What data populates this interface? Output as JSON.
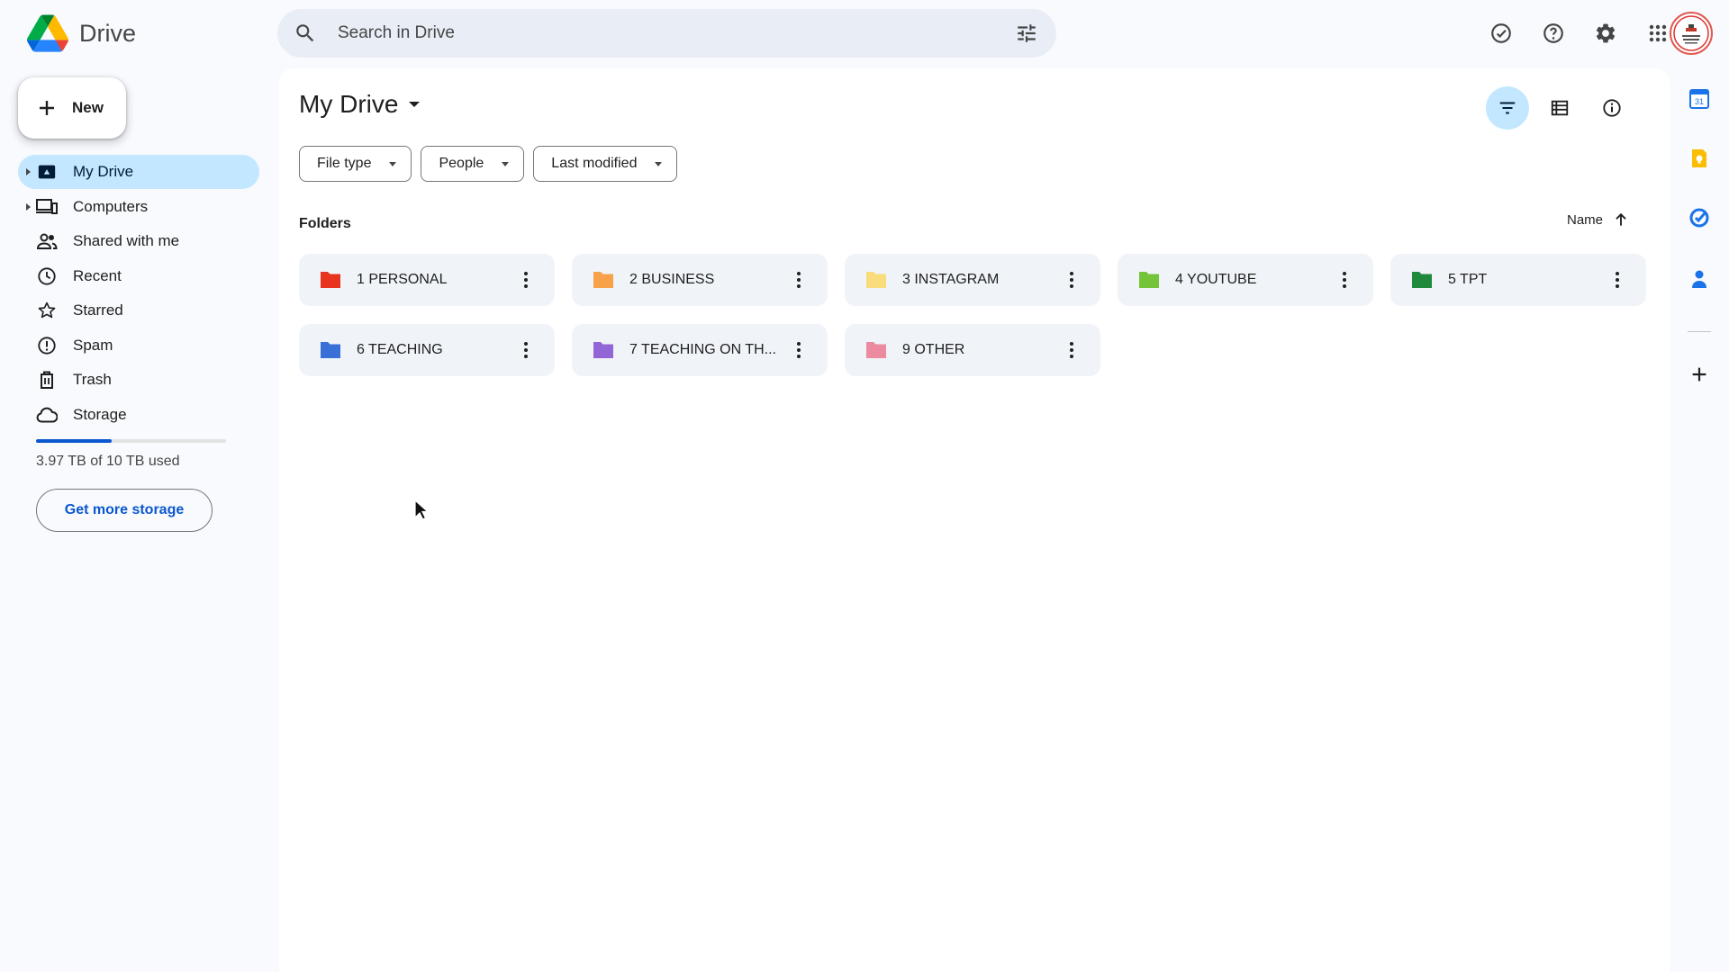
{
  "app": {
    "name": "Drive"
  },
  "search": {
    "placeholder": "Search in Drive"
  },
  "header_icons": [
    "offline-ready-icon",
    "help-icon",
    "settings-icon",
    "apps-grid-icon"
  ],
  "new_button": {
    "label": "New"
  },
  "sidebar": {
    "items": [
      {
        "label": "My Drive",
        "icon": "my-drive-icon",
        "active": true
      },
      {
        "label": "Computers",
        "icon": "computers-icon"
      },
      {
        "label": "Shared with me",
        "icon": "shared-icon"
      },
      {
        "label": "Recent",
        "icon": "clock-icon"
      },
      {
        "label": "Starred",
        "icon": "star-icon"
      },
      {
        "label": "Spam",
        "icon": "spam-icon"
      },
      {
        "label": "Trash",
        "icon": "trash-icon"
      },
      {
        "label": "Storage",
        "icon": "cloud-icon"
      }
    ],
    "storage": {
      "used_fraction": 0.397,
      "text": "3.97 TB of 10 TB used",
      "button": "Get more storage"
    }
  },
  "main": {
    "title": "My Drive",
    "filters": [
      "File type",
      "People",
      "Last modified"
    ],
    "section_label": "Folders",
    "sort_label": "Name",
    "folders": [
      {
        "name": "1 PERSONAL",
        "color": "#e8331f"
      },
      {
        "name": "2 BUSINESS",
        "color": "#f7a14a"
      },
      {
        "name": "3 INSTAGRAM",
        "color": "#f9dc7b"
      },
      {
        "name": "4 YOUTUBE",
        "color": "#74c43a"
      },
      {
        "name": "5 TPT",
        "color": "#1f8a3b"
      },
      {
        "name": "6 TEACHING",
        "color": "#3a6fd8"
      },
      {
        "name": "7 TEACHING ON TH...",
        "color": "#9366d8"
      },
      {
        "name": "9 OTHER",
        "color": "#ec8aa0"
      }
    ]
  },
  "side_panel": {
    "apps": [
      "calendar-icon",
      "keep-icon",
      "tasks-icon",
      "contacts-icon"
    ],
    "calendar_day": "31"
  },
  "colors": {
    "accent": "#0b57d0",
    "active_bg": "#c2e7ff",
    "page_bg": "#f8fafd"
  }
}
